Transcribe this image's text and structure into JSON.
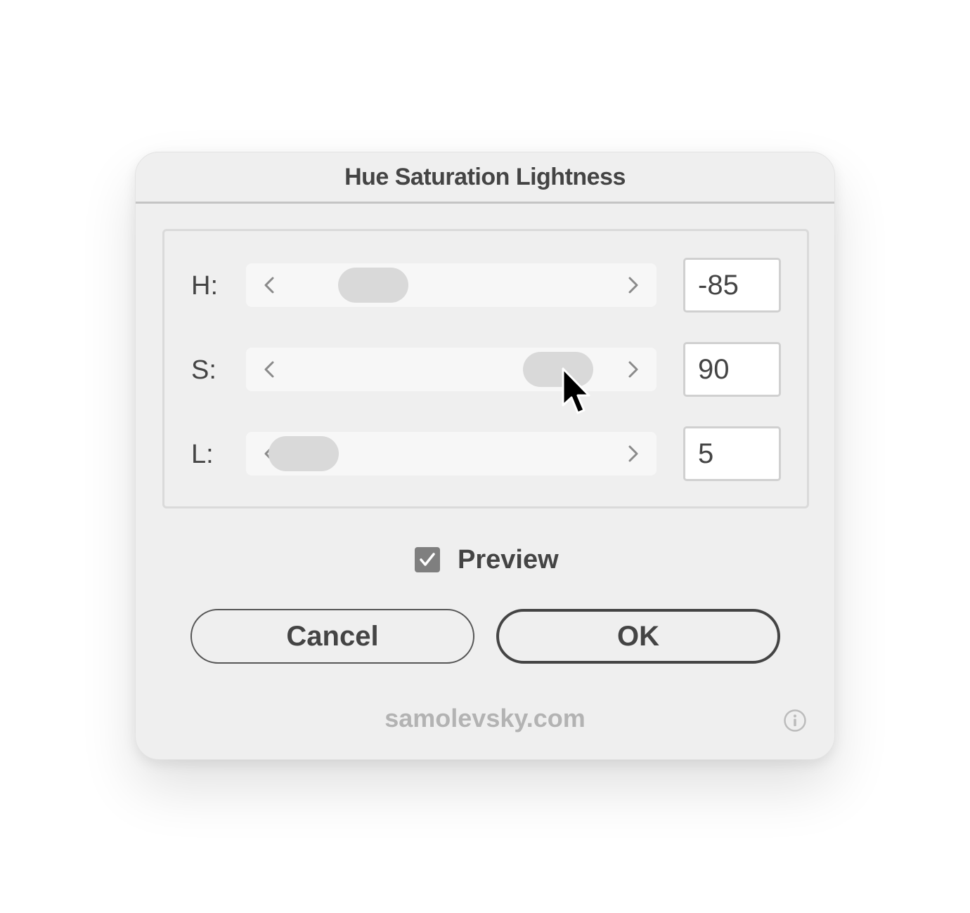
{
  "dialog": {
    "title": "Hue Saturation Lightness"
  },
  "sliders": [
    {
      "label": "H:",
      "value": "-85",
      "position": 0.31
    },
    {
      "label": "S:",
      "value": "90",
      "position": 0.76
    },
    {
      "label": "L:",
      "value": "5",
      "position": 0.14
    }
  ],
  "preview": {
    "label": "Preview",
    "checked": true
  },
  "buttons": {
    "cancel_label": "Cancel",
    "ok_label": "OK"
  },
  "footer": {
    "text": "samolevsky.com"
  },
  "icons": {
    "checkbox": "checkmark-icon",
    "info": "info-icon",
    "cursor": "pointer-cursor-icon",
    "slider_left": "chevron-left-icon",
    "slider_right": "chevron-right-icon"
  },
  "colors": {
    "dialog_bg": "#efefef",
    "text": "#444444",
    "checkbox_fill": "#7f7f7f",
    "footer_text": "#b3b3b3"
  }
}
